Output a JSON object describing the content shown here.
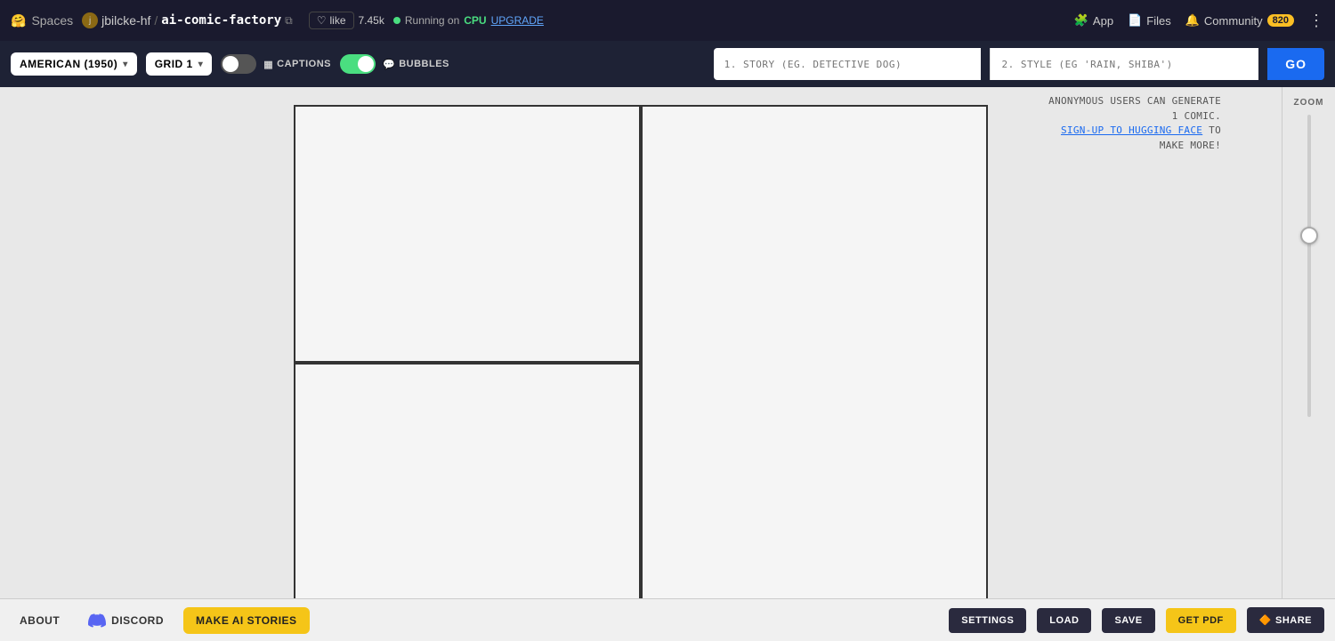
{
  "nav": {
    "spaces_label": "Spaces",
    "user": "jbilcke-hf",
    "repo": "ai-comic-factory",
    "copy_title": "Copy link",
    "like_label": "like",
    "like_count": "7.45k",
    "status_running": "Running on",
    "status_cpu": "CPU",
    "status_upgrade": "UPGRADE",
    "app_label": "App",
    "files_label": "Files",
    "community_label": "Community",
    "community_count": "820",
    "more_label": "⋮"
  },
  "toolbar": {
    "layout_value": "AMERICAN (1950)",
    "grid_value": "GRID 1",
    "captions_label": "CAPTIONS",
    "bubbles_label": "BUBBLES",
    "story_placeholder": "1. STORY (EG. DETECTIVE DOG)",
    "style_placeholder": "2. STYLE (EG 'RAIN, SHIBA')",
    "go_label": "GO"
  },
  "info": {
    "anonymous_text": "ANONYMOUS USERS CAN GENERATE 1 COMIC.",
    "signup_text": "SIGN-UP TO HUGGING FACE",
    "more_text": "TO MAKE MORE!",
    "zoom_label": "ZOOM"
  },
  "bottom": {
    "about_label": "ABOUT",
    "discord_label": "DISCORD",
    "make_stories_label": "MAKE AI STORIES",
    "settings_label": "SETTINGS",
    "load_label": "LOAD",
    "save_label": "SAVE",
    "get_pdf_label": "GET PDF",
    "share_label": "SHARE",
    "share_icon": "🔶"
  }
}
